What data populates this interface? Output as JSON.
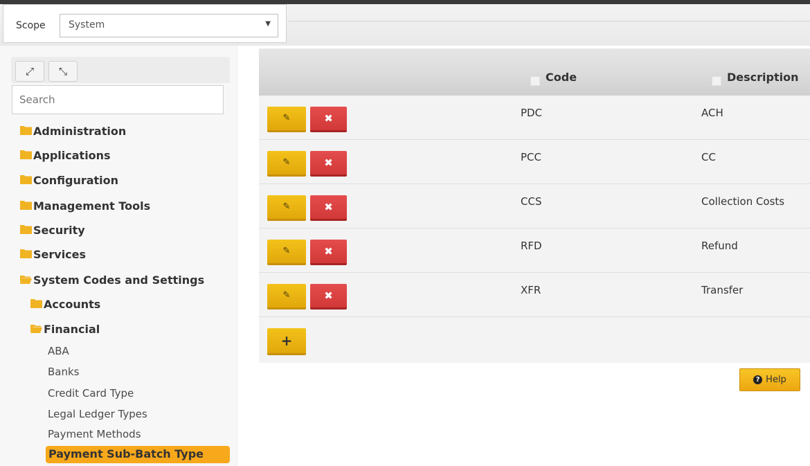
{
  "scope": {
    "label": "Scope",
    "selected_value": "System",
    "dropdown_arrow": "▼"
  },
  "sidebar": {
    "tool_buttons": [
      {
        "icon": "expand-icon",
        "glyph": "⤢"
      },
      {
        "icon": "collapse-icon",
        "glyph": "⤡"
      }
    ],
    "search_placeholder": "Search",
    "tree": {
      "top_level": [
        {
          "label": "Administration",
          "state": "closed"
        },
        {
          "label": "Applications",
          "state": "closed"
        },
        {
          "label": "Configuration",
          "state": "closed"
        },
        {
          "label": "Management Tools",
          "state": "closed"
        },
        {
          "label": "Security",
          "state": "closed"
        },
        {
          "label": "Services",
          "state": "closed"
        },
        {
          "label": "System Codes and Settings",
          "state": "open"
        }
      ],
      "sub_level": [
        {
          "label": "Accounts",
          "state": "closed"
        },
        {
          "label": "Financial",
          "state": "open"
        }
      ],
      "leaves": [
        "ABA",
        "Banks",
        "Credit Card Type",
        "Legal Ledger Types",
        "Payment Methods"
      ],
      "selected_leaf": "Payment Sub-Batch Type"
    },
    "folder_color": "#f0b322"
  },
  "grid": {
    "columns": [
      "Code",
      "Description"
    ],
    "rows": [
      {
        "code": "PDC",
        "description": "ACH"
      },
      {
        "code": "PCC",
        "description": "CC"
      },
      {
        "code": "CCS",
        "description": "Collection Costs"
      },
      {
        "code": "RFD",
        "description": "Refund"
      },
      {
        "code": "XFR",
        "description": "Transfer"
      }
    ],
    "edit_glyph": "✎",
    "delete_glyph": "✖",
    "add_glyph": "+"
  },
  "help": {
    "label": "Help",
    "icon_glyph": "?"
  },
  "colors": {
    "accent_yellow": "#f3c21a",
    "delete_red": "#e44d4d",
    "selected_orange": "#f7a81b"
  }
}
